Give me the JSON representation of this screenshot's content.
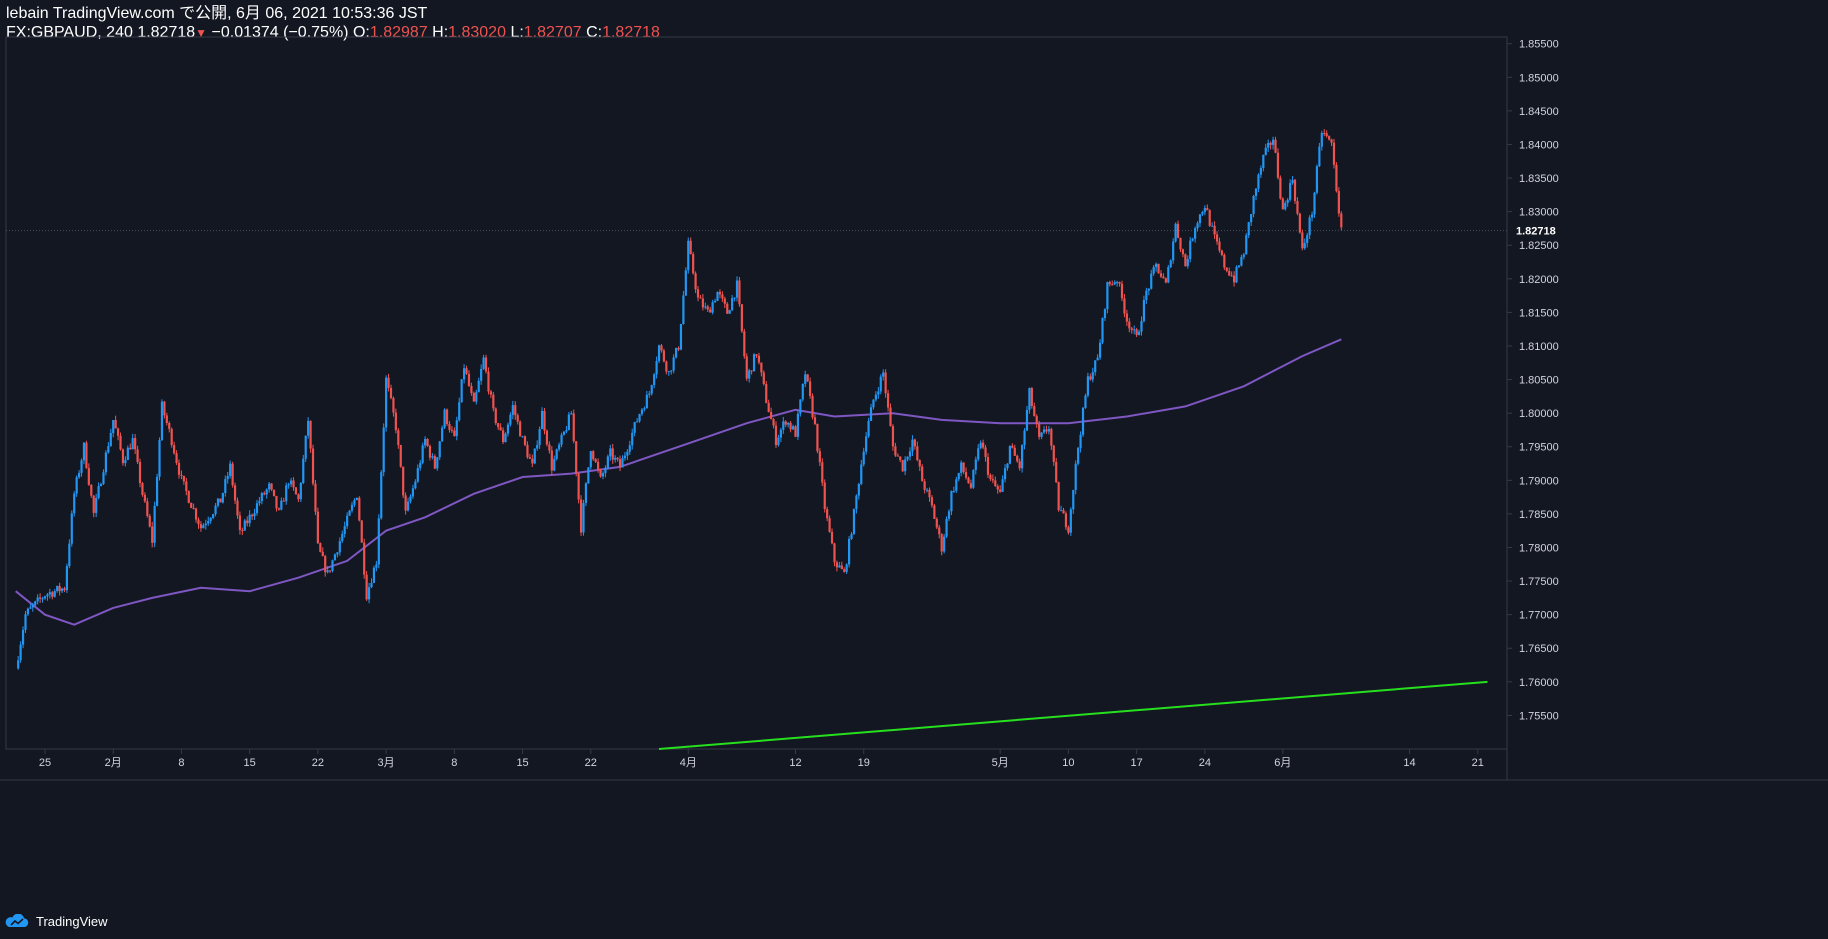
{
  "header": {
    "line1": "lebain TradingView.com で公開, 6月 06, 2021 10:53:36 JST",
    "symbol": "FX:GBPAUD, 240",
    "last": "1.82718",
    "change": "−0.01374 (−0.75%)",
    "o_label": "O:",
    "o_value": "1.82987",
    "h_label": "H:",
    "h_value": "1.83020",
    "l_label": "L:",
    "l_value": "1.82707",
    "c_label": "C:",
    "c_value": "1.82718"
  },
  "footer": {
    "brand": "TradingView"
  },
  "colors": {
    "background": "#131722",
    "up": "#2196f3",
    "down": "#ef5350",
    "ma": "#7e57c2",
    "trendline": "#26e01e",
    "axis_text": "#d1d4dc",
    "axis_line": "#363a45"
  },
  "chart_data": {
    "type": "candlestick",
    "symbol": "FX:GBPAUD",
    "interval": "240",
    "last_price": 1.82718,
    "last_price_label": "1.82718",
    "ylim": [
      1.75,
      1.856
    ],
    "y_ticks": [
      "1.75500",
      "1.76000",
      "1.76500",
      "1.77000",
      "1.77500",
      "1.78000",
      "1.78500",
      "1.79000",
      "1.79500",
      "1.80000",
      "1.80500",
      "1.81000",
      "1.81500",
      "1.82000",
      "1.82500",
      "1.83000",
      "1.83500",
      "1.84000",
      "1.84500",
      "1.85000",
      "1.85500"
    ],
    "x_ticks": [
      {
        "label": "25",
        "date": "2021-01-25"
      },
      {
        "label": "2月",
        "date": "2021-02-01"
      },
      {
        "label": "8",
        "date": "2021-02-08"
      },
      {
        "label": "15",
        "date": "2021-02-15"
      },
      {
        "label": "22",
        "date": "2021-02-22"
      },
      {
        "label": "3月",
        "date": "2021-03-01"
      },
      {
        "label": "8",
        "date": "2021-03-08"
      },
      {
        "label": "15",
        "date": "2021-03-15"
      },
      {
        "label": "22",
        "date": "2021-03-22"
      },
      {
        "label": "4月",
        "date": "2021-04-01"
      },
      {
        "label": "12",
        "date": "2021-04-12"
      },
      {
        "label": "19",
        "date": "2021-04-19"
      },
      {
        "label": "5月",
        "date": "2021-05-03"
      },
      {
        "label": "10",
        "date": "2021-05-10"
      },
      {
        "label": "17",
        "date": "2021-05-17"
      },
      {
        "label": "24",
        "date": "2021-05-24"
      },
      {
        "label": "6月",
        "date": "2021-06-01"
      },
      {
        "label": "14",
        "date": "2021-06-14"
      },
      {
        "label": "21",
        "date": "2021-06-21"
      }
    ],
    "close_path": [
      [
        "2021-01-22",
        1.762
      ],
      [
        "2021-01-23",
        1.77
      ],
      [
        "2021-01-25",
        1.773
      ],
      [
        "2021-01-27",
        1.774
      ],
      [
        "2021-01-28",
        1.788
      ],
      [
        "2021-01-29",
        1.795
      ],
      [
        "2021-01-30",
        1.785
      ],
      [
        "2021-02-01",
        1.799
      ],
      [
        "2021-02-02",
        1.793
      ],
      [
        "2021-02-03",
        1.796
      ],
      [
        "2021-02-04",
        1.788
      ],
      [
        "2021-02-05",
        1.781
      ],
      [
        "2021-02-06",
        1.801
      ],
      [
        "2021-02-07",
        1.796
      ],
      [
        "2021-02-08",
        1.79
      ],
      [
        "2021-02-10",
        1.783
      ],
      [
        "2021-02-12",
        1.787
      ],
      [
        "2021-02-13",
        1.792
      ],
      [
        "2021-02-14",
        1.782
      ],
      [
        "2021-02-16",
        1.787
      ],
      [
        "2021-02-17",
        1.789
      ],
      [
        "2021-02-18",
        1.785
      ],
      [
        "2021-02-19",
        1.79
      ],
      [
        "2021-02-20",
        1.787
      ],
      [
        "2021-02-21",
        1.799
      ],
      [
        "2021-02-22",
        1.78
      ],
      [
        "2021-02-23",
        1.776
      ],
      [
        "2021-02-25",
        1.784
      ],
      [
        "2021-02-26",
        1.788
      ],
      [
        "2021-02-27",
        1.773
      ],
      [
        "2021-02-28",
        1.778
      ],
      [
        "2021-03-01",
        1.805
      ],
      [
        "2021-03-02",
        1.798
      ],
      [
        "2021-03-03",
        1.785
      ],
      [
        "2021-03-04",
        1.79
      ],
      [
        "2021-03-05",
        1.796
      ],
      [
        "2021-03-06",
        1.792
      ],
      [
        "2021-03-07",
        1.8
      ],
      [
        "2021-03-08",
        1.796
      ],
      [
        "2021-03-09",
        1.807
      ],
      [
        "2021-03-10",
        1.801
      ],
      [
        "2021-03-11",
        1.808
      ],
      [
        "2021-03-12",
        1.8
      ],
      [
        "2021-03-13",
        1.796
      ],
      [
        "2021-03-14",
        1.801
      ],
      [
        "2021-03-15",
        1.796
      ],
      [
        "2021-03-16",
        1.792
      ],
      [
        "2021-03-17",
        1.8
      ],
      [
        "2021-03-18",
        1.792
      ],
      [
        "2021-03-19",
        1.796
      ],
      [
        "2021-03-20",
        1.8
      ],
      [
        "2021-03-21",
        1.783
      ],
      [
        "2021-03-22",
        1.795
      ],
      [
        "2021-03-23",
        1.79
      ],
      [
        "2021-03-24",
        1.794
      ],
      [
        "2021-03-25",
        1.792
      ],
      [
        "2021-03-26",
        1.796
      ],
      [
        "2021-03-27",
        1.8
      ],
      [
        "2021-03-28",
        1.803
      ],
      [
        "2021-03-29",
        1.81
      ],
      [
        "2021-03-30",
        1.806
      ],
      [
        "2021-03-31",
        1.81
      ],
      [
        "2021-04-01",
        1.825
      ],
      [
        "2021-04-02",
        1.817
      ],
      [
        "2021-04-03",
        1.815
      ],
      [
        "2021-04-04",
        1.818
      ],
      [
        "2021-04-05",
        1.815
      ],
      [
        "2021-04-06",
        1.819
      ],
      [
        "2021-04-07",
        1.805
      ],
      [
        "2021-04-08",
        1.809
      ],
      [
        "2021-04-09",
        1.802
      ],
      [
        "2021-04-10",
        1.796
      ],
      [
        "2021-04-11",
        1.799
      ],
      [
        "2021-04-12",
        1.797
      ],
      [
        "2021-04-13",
        1.806
      ],
      [
        "2021-04-14",
        1.798
      ],
      [
        "2021-04-15",
        1.786
      ],
      [
        "2021-04-16",
        1.778
      ],
      [
        "2021-04-17",
        1.776
      ],
      [
        "2021-04-18",
        1.785
      ],
      [
        "2021-04-19",
        1.795
      ],
      [
        "2021-04-20",
        1.802
      ],
      [
        "2021-04-21",
        1.806
      ],
      [
        "2021-04-22",
        1.795
      ],
      [
        "2021-04-23",
        1.792
      ],
      [
        "2021-04-24",
        1.796
      ],
      [
        "2021-04-25",
        1.79
      ],
      [
        "2021-04-26",
        1.786
      ],
      [
        "2021-04-27",
        1.78
      ],
      [
        "2021-04-28",
        1.788
      ],
      [
        "2021-04-29",
        1.792
      ],
      [
        "2021-04-30",
        1.789
      ],
      [
        "2021-05-01",
        1.796
      ],
      [
        "2021-05-02",
        1.79
      ],
      [
        "2021-05-03",
        1.788
      ],
      [
        "2021-05-04",
        1.795
      ],
      [
        "2021-05-05",
        1.792
      ],
      [
        "2021-05-06",
        1.803
      ],
      [
        "2021-05-07",
        1.796
      ],
      [
        "2021-05-08",
        1.798
      ],
      [
        "2021-05-09",
        1.786
      ],
      [
        "2021-05-10",
        1.783
      ],
      [
        "2021-05-11",
        1.795
      ],
      [
        "2021-05-12",
        1.805
      ],
      [
        "2021-05-13",
        1.808
      ],
      [
        "2021-05-14",
        1.819
      ],
      [
        "2021-05-15",
        1.82
      ],
      [
        "2021-05-16",
        1.814
      ],
      [
        "2021-05-17",
        1.811
      ],
      [
        "2021-05-18",
        1.818
      ],
      [
        "2021-05-19",
        1.822
      ],
      [
        "2021-05-20",
        1.819
      ],
      [
        "2021-05-21",
        1.828
      ],
      [
        "2021-05-22",
        1.822
      ],
      [
        "2021-05-23",
        1.828
      ],
      [
        "2021-05-24",
        1.831
      ],
      [
        "2021-05-25",
        1.826
      ],
      [
        "2021-05-26",
        1.822
      ],
      [
        "2021-05-27",
        1.82
      ],
      [
        "2021-05-28",
        1.824
      ],
      [
        "2021-05-29",
        1.832
      ],
      [
        "2021-05-30",
        1.838
      ],
      [
        "2021-05-31",
        1.841
      ],
      [
        "2021-06-01",
        1.83
      ],
      [
        "2021-06-02",
        1.835
      ],
      [
        "2021-06-03",
        1.824
      ],
      [
        "2021-06-04",
        1.83
      ],
      [
        "2021-06-05",
        1.842
      ],
      [
        "2021-06-06",
        1.84
      ],
      [
        "2021-06-07",
        1.827
      ]
    ],
    "moving_average": [
      [
        "2021-01-22",
        1.7735
      ],
      [
        "2021-01-25",
        1.77
      ],
      [
        "2021-01-28",
        1.7685
      ],
      [
        "2021-02-01",
        1.771
      ],
      [
        "2021-02-05",
        1.7725
      ],
      [
        "2021-02-10",
        1.774
      ],
      [
        "2021-02-15",
        1.7735
      ],
      [
        "2021-02-20",
        1.7755
      ],
      [
        "2021-02-25",
        1.778
      ],
      [
        "2021-03-01",
        1.7825
      ],
      [
        "2021-03-05",
        1.7845
      ],
      [
        "2021-03-10",
        1.788
      ],
      [
        "2021-03-15",
        1.7905
      ],
      [
        "2021-03-20",
        1.791
      ],
      [
        "2021-03-25",
        1.792
      ],
      [
        "2021-04-01",
        1.7955
      ],
      [
        "2021-04-07",
        1.7985
      ],
      [
        "2021-04-12",
        1.8005
      ],
      [
        "2021-04-16",
        1.7995
      ],
      [
        "2021-04-22",
        1.8
      ],
      [
        "2021-04-27",
        1.799
      ],
      [
        "2021-05-03",
        1.7985
      ],
      [
        "2021-05-10",
        1.7985
      ],
      [
        "2021-05-16",
        1.7995
      ],
      [
        "2021-05-22",
        1.801
      ],
      [
        "2021-05-28",
        1.804
      ],
      [
        "2021-06-03",
        1.8085
      ],
      [
        "2021-06-07",
        1.811
      ]
    ],
    "trendline": [
      [
        "2021-03-29",
        1.75
      ],
      [
        "2021-06-22",
        1.76
      ]
    ]
  }
}
